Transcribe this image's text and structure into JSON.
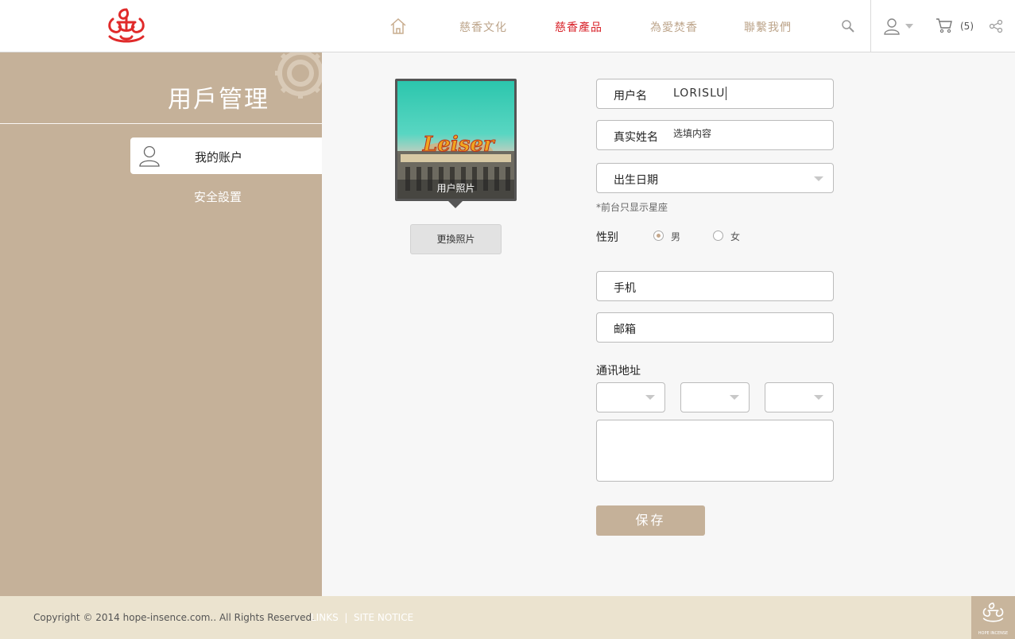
{
  "header": {
    "nav": [
      {
        "label": "慈香文化",
        "active": false
      },
      {
        "label": "慈香產品",
        "active": true
      },
      {
        "label": "為愛焚香",
        "active": false
      },
      {
        "label": "聯繫我們",
        "active": false
      }
    ],
    "cart_count": "(5)",
    "colors": {
      "accent": "#d8232a",
      "nav": "#bda58b"
    }
  },
  "sidebar": {
    "title": "用戶管理",
    "items": [
      {
        "label": "我的账户",
        "active": true
      },
      {
        "label": "安全設置",
        "active": false
      }
    ],
    "color": "#c5b199"
  },
  "photo": {
    "label": "用户照片",
    "change_button": "更換照片"
  },
  "form": {
    "username": {
      "label": "用户名",
      "value": "LORISLU"
    },
    "realname": {
      "label": "真实姓名",
      "placeholder": "选填内容"
    },
    "birthday": {
      "label": "出生日期"
    },
    "note": "*前台只显示星座",
    "gender": {
      "label": "性别",
      "male": "男",
      "female": "女",
      "selected": "男"
    },
    "phone": {
      "label": "手机"
    },
    "email": {
      "label": "邮箱"
    },
    "address": {
      "label": "通讯地址"
    },
    "save_button": "保存"
  },
  "footer": {
    "copyright": "Copyright © 2014 hope-insence.com.. All Rights Reserved.",
    "links": "LINKS",
    "separator": "|",
    "site_notice": "SITE NOTICE",
    "logo_text": "HOPE INCENSE"
  }
}
